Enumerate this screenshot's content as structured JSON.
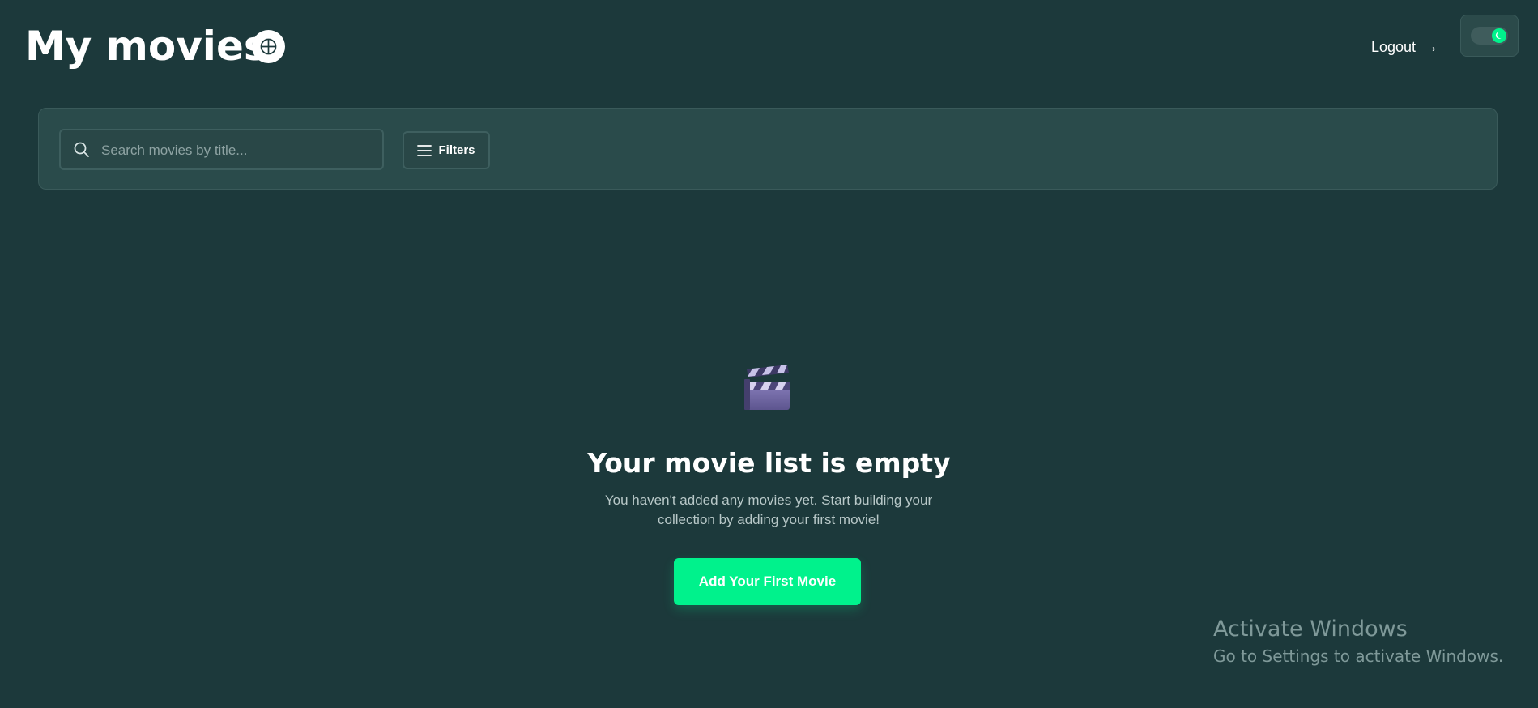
{
  "header": {
    "title": "My movies",
    "add_icon": "circle-plus-icon",
    "logout_label": "Logout",
    "logout_icon": "arrow-right-icon",
    "theme_toggle_icon": "moon-icon"
  },
  "search": {
    "placeholder": "Search movies by title...",
    "value": "",
    "search_icon": "search-icon",
    "filters_label": "Filters",
    "filters_icon": "menu-lines-icon"
  },
  "empty_state": {
    "icon": "clapperboard-icon",
    "title": "Your movie list is empty",
    "description": "You haven't added any movies yet. Start building your collection by adding your first movie!",
    "button_label": "Add Your First Movie"
  },
  "watermark": {
    "title": "Activate Windows",
    "subtitle": "Go to Settings to activate Windows."
  },
  "colors": {
    "background": "#1c393b",
    "panel": "#2a4b4b",
    "accent": "#00f28c"
  }
}
